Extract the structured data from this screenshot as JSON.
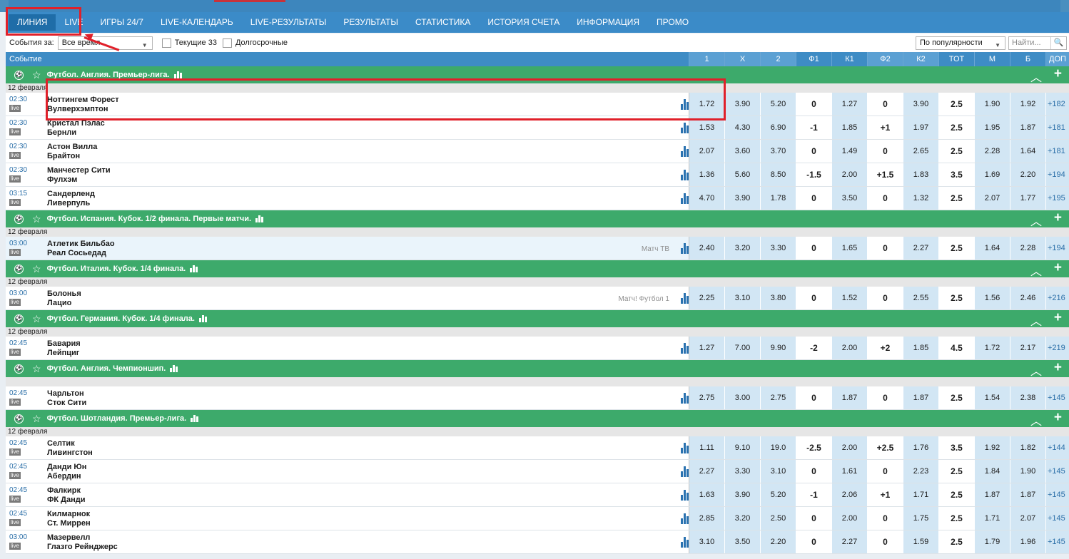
{
  "nav": {
    "items": [
      "ЛИНИЯ",
      "LIVE",
      "ИГРЫ 24/7",
      "LIVE-КАЛЕНДАРЬ",
      "LIVE-РЕЗУЛЬТАТЫ",
      "РЕЗУЛЬТАТЫ",
      "СТАТИСТИКА",
      "ИСТОРИЯ СЧЕТА",
      "ИНФОРМАЦИЯ",
      "ПРОМО"
    ],
    "active_index": 0
  },
  "filter": {
    "events_label": "События за:",
    "period_value": "Все время",
    "current_label": "Текущие 33",
    "longterm_label": "Долгосрочные",
    "sort_value": "По популярности",
    "search_placeholder": "Найти..."
  },
  "header": {
    "event_label": "Событие",
    "columns": [
      "1",
      "X",
      "2",
      "Ф1",
      "К1",
      "Ф2",
      "К2",
      "ТОТ",
      "М",
      "Б",
      "ДОП"
    ]
  },
  "groups": [
    {
      "title": "Футбол. Англия. Премьер-лига.",
      "date": "12 февраля",
      "matches": [
        {
          "time": "02:30",
          "live": "live",
          "home": "Ноттингем Форест",
          "away": "Вулверхэмптон",
          "tv": "",
          "odds": [
            "1.72",
            "3.90",
            "5.20",
            "0",
            "1.27",
            "0",
            "3.90",
            "2.5",
            "1.90",
            "1.92"
          ],
          "dop": "+182"
        },
        {
          "time": "02:30",
          "live": "live",
          "home": "Кристал Пэлас",
          "away": "Бернли",
          "tv": "",
          "odds": [
            "1.53",
            "4.30",
            "6.90",
            "-1",
            "1.85",
            "+1",
            "1.97",
            "2.5",
            "1.95",
            "1.87"
          ],
          "dop": "+181"
        },
        {
          "time": "02:30",
          "live": "live",
          "home": "Астон Вилла",
          "away": "Брайтон",
          "tv": "",
          "odds": [
            "2.07",
            "3.60",
            "3.70",
            "0",
            "1.49",
            "0",
            "2.65",
            "2.5",
            "2.28",
            "1.64"
          ],
          "dop": "+181"
        },
        {
          "time": "02:30",
          "live": "live",
          "home": "Манчестер Сити",
          "away": "Фулхэм",
          "tv": "",
          "odds": [
            "1.36",
            "5.60",
            "8.50",
            "-1.5",
            "2.00",
            "+1.5",
            "1.83",
            "3.5",
            "1.69",
            "2.20"
          ],
          "dop": "+194"
        },
        {
          "time": "03:15",
          "live": "live",
          "home": "Сандерленд",
          "away": "Ливерпуль",
          "tv": "",
          "odds": [
            "4.70",
            "3.90",
            "1.78",
            "0",
            "3.50",
            "0",
            "1.32",
            "2.5",
            "2.07",
            "1.77"
          ],
          "dop": "+195"
        }
      ]
    },
    {
      "title": "Футбол. Испания. Кубок. 1/2 финала. Первые матчи.",
      "date": "12 февраля",
      "matches": [
        {
          "time": "03:00",
          "live": "live",
          "home": "Атлетик Бильбао",
          "away": "Реал Сосьедад",
          "tv": "Матч ТВ",
          "alt": true,
          "odds": [
            "2.40",
            "3.20",
            "3.30",
            "0",
            "1.65",
            "0",
            "2.27",
            "2.5",
            "1.64",
            "2.28"
          ],
          "dop": "+194"
        }
      ]
    },
    {
      "title": "Футбол. Италия. Кубок. 1/4 финала.",
      "date": "12 февраля",
      "matches": [
        {
          "time": "03:00",
          "live": "live",
          "home": "Болонья",
          "away": "Лацио",
          "tv": "Матч! Футбол 1",
          "odds": [
            "2.25",
            "3.10",
            "3.80",
            "0",
            "1.52",
            "0",
            "2.55",
            "2.5",
            "1.56",
            "2.46"
          ],
          "dop": "+216"
        }
      ]
    },
    {
      "title": "Футбол. Германия. Кубок. 1/4 финала.",
      "date": "12 февраля",
      "matches": [
        {
          "time": "02:45",
          "live": "live",
          "home": "Бавария",
          "away": "Лейпциг",
          "tv": "",
          "odds": [
            "1.27",
            "7.00",
            "9.90",
            "-2",
            "2.00",
            "+2",
            "1.85",
            "4.5",
            "1.72",
            "2.17"
          ],
          "dop": "+219"
        }
      ]
    },
    {
      "title": "Футбол. Англия. Чемпионшип.",
      "date": "",
      "matches": [
        {
          "time": "02:45",
          "live": "live",
          "home": "Чарльтон",
          "away": "Сток Сити",
          "tv": "",
          "odds": [
            "2.75",
            "3.00",
            "2.75",
            "0",
            "1.87",
            "0",
            "1.87",
            "2.5",
            "1.54",
            "2.38"
          ],
          "dop": "+145"
        }
      ]
    },
    {
      "title": "Футбол. Шотландия. Премьер-лига.",
      "date": "12 февраля",
      "matches": [
        {
          "time": "02:45",
          "live": "live",
          "home": "Селтик",
          "away": "Ливингстон",
          "tv": "",
          "odds": [
            "1.11",
            "9.10",
            "19.0",
            "-2.5",
            "2.00",
            "+2.5",
            "1.76",
            "3.5",
            "1.92",
            "1.82"
          ],
          "dop": "+144"
        },
        {
          "time": "02:45",
          "live": "live",
          "home": "Данди Юн",
          "away": "Абердин",
          "tv": "",
          "odds": [
            "2.27",
            "3.30",
            "3.10",
            "0",
            "1.61",
            "0",
            "2.23",
            "2.5",
            "1.84",
            "1.90"
          ],
          "dop": "+145"
        },
        {
          "time": "02:45",
          "live": "live",
          "home": "Фалкирк",
          "away": "ФК Данди",
          "tv": "",
          "odds": [
            "1.63",
            "3.90",
            "5.20",
            "-1",
            "2.06",
            "+1",
            "1.71",
            "2.5",
            "1.87",
            "1.87"
          ],
          "dop": "+145"
        },
        {
          "time": "02:45",
          "live": "live",
          "home": "Килмарнок",
          "away": "Ст. Миррен",
          "tv": "",
          "odds": [
            "2.85",
            "3.20",
            "2.50",
            "0",
            "2.00",
            "0",
            "1.75",
            "2.5",
            "1.71",
            "2.07"
          ],
          "dop": "+145"
        },
        {
          "time": "03:00",
          "live": "live",
          "home": "Мазервелл",
          "away": "Глазго Рейнджерс",
          "tv": "",
          "odds": [
            "3.10",
            "3.50",
            "2.20",
            "0",
            "2.27",
            "0",
            "1.59",
            "2.5",
            "1.79",
            "1.96"
          ],
          "dop": "+145"
        }
      ]
    }
  ],
  "colors": {
    "nav": "#3b8bc8",
    "group": "#3daa6b",
    "odds": "#d2e6f4",
    "annotation": "#e0202a"
  }
}
